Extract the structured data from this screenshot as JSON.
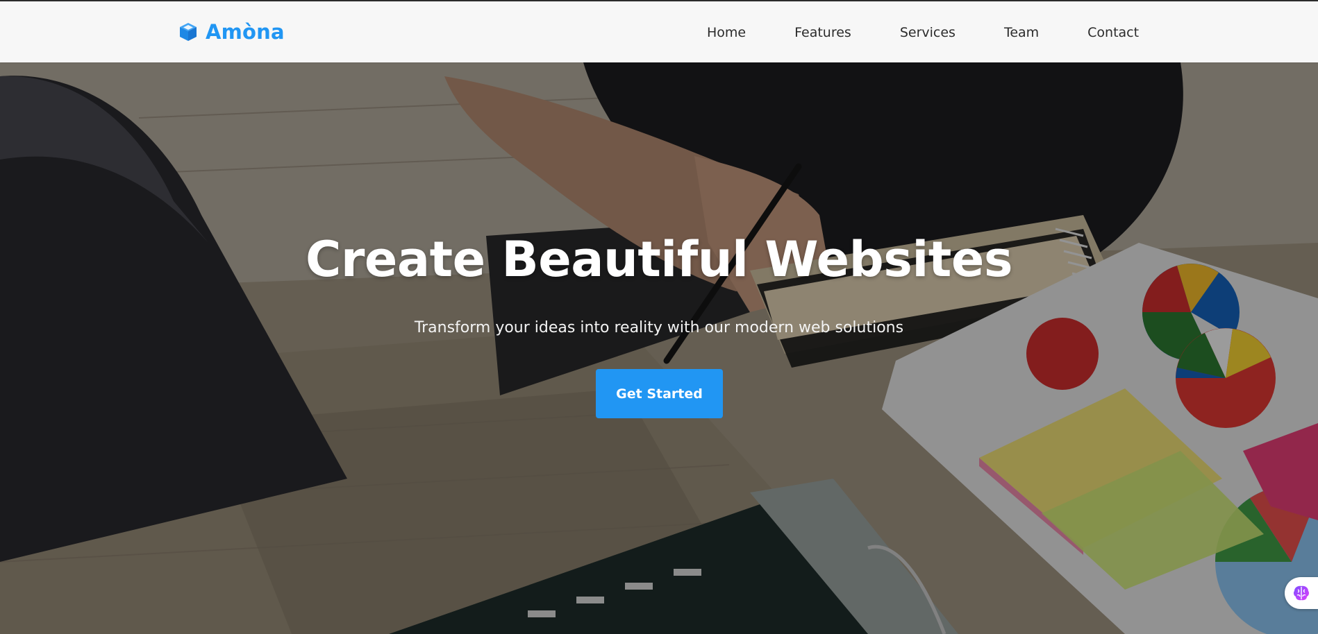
{
  "brand": {
    "name": "Amòna",
    "icon": "cube-icon",
    "color": "#2196f3"
  },
  "nav": {
    "items": [
      {
        "label": "Home"
      },
      {
        "label": "Features"
      },
      {
        "label": "Services"
      },
      {
        "label": "Team"
      },
      {
        "label": "Contact"
      }
    ]
  },
  "hero": {
    "title": "Create Beautiful Websites",
    "subtitle": "Transform your ideas into reality with our modern web solutions",
    "cta_label": "Get Started",
    "background": "office-desk-photo"
  },
  "assistant_widget": {
    "icon": "brain-icon"
  },
  "colors": {
    "accent": "#2196f3",
    "navbar_bg": "#f7f7f7",
    "nav_text": "#2b2b2b"
  }
}
